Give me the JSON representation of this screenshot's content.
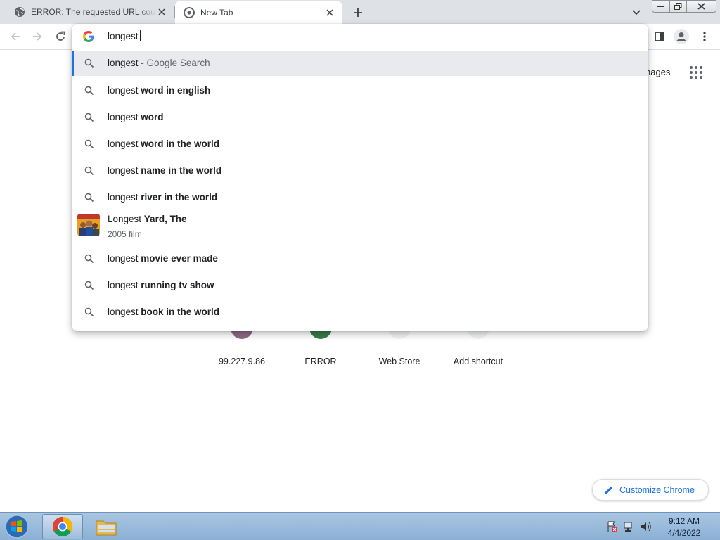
{
  "tabs": [
    {
      "title": "ERROR: The requested URL could not be retrieved",
      "favicon": "globe-icon",
      "active": false
    },
    {
      "title": "New Tab",
      "favicon": "chrome-newtab-icon",
      "active": true
    }
  ],
  "omnibox": {
    "input_value": "longest",
    "suggestions": [
      {
        "prefix": "longest",
        "bold": "",
        "dim": " - Google Search",
        "icon": "search-icon",
        "selected": true
      },
      {
        "prefix": "longest ",
        "bold": "word in english",
        "icon": "search-icon"
      },
      {
        "prefix": "longest ",
        "bold": "word",
        "icon": "search-icon"
      },
      {
        "prefix": "longest ",
        "bold": "word in the world",
        "icon": "search-icon"
      },
      {
        "prefix": "longest ",
        "bold": "name in the world",
        "icon": "search-icon"
      },
      {
        "prefix": "longest ",
        "bold": "river in the world",
        "icon": "search-icon"
      },
      {
        "prefix": "Longest ",
        "bold": "Yard, The",
        "subtitle": "2005 film",
        "icon": "movie-thumbnail"
      },
      {
        "prefix": "longest ",
        "bold": "movie ever made",
        "icon": "search-icon"
      },
      {
        "prefix": "longest ",
        "bold": "running tv show",
        "icon": "search-icon"
      },
      {
        "prefix": "longest ",
        "bold": "book in the world",
        "icon": "search-icon"
      }
    ]
  },
  "ntp": {
    "images_link": "Images",
    "images_visible": "nages",
    "shortcuts": [
      {
        "label": "99.227.9.86"
      },
      {
        "label": "ERROR"
      },
      {
        "label": "Web Store"
      },
      {
        "label": "Add shortcut"
      }
    ],
    "customize_label": "Customize Chrome"
  },
  "taskbar": {
    "time": "9:12 AM",
    "date": "4/4/2022"
  },
  "colors": {
    "accent": "#1a73e8",
    "tabstrip": "#dee1e6",
    "selected_row": "#e8eaed"
  }
}
